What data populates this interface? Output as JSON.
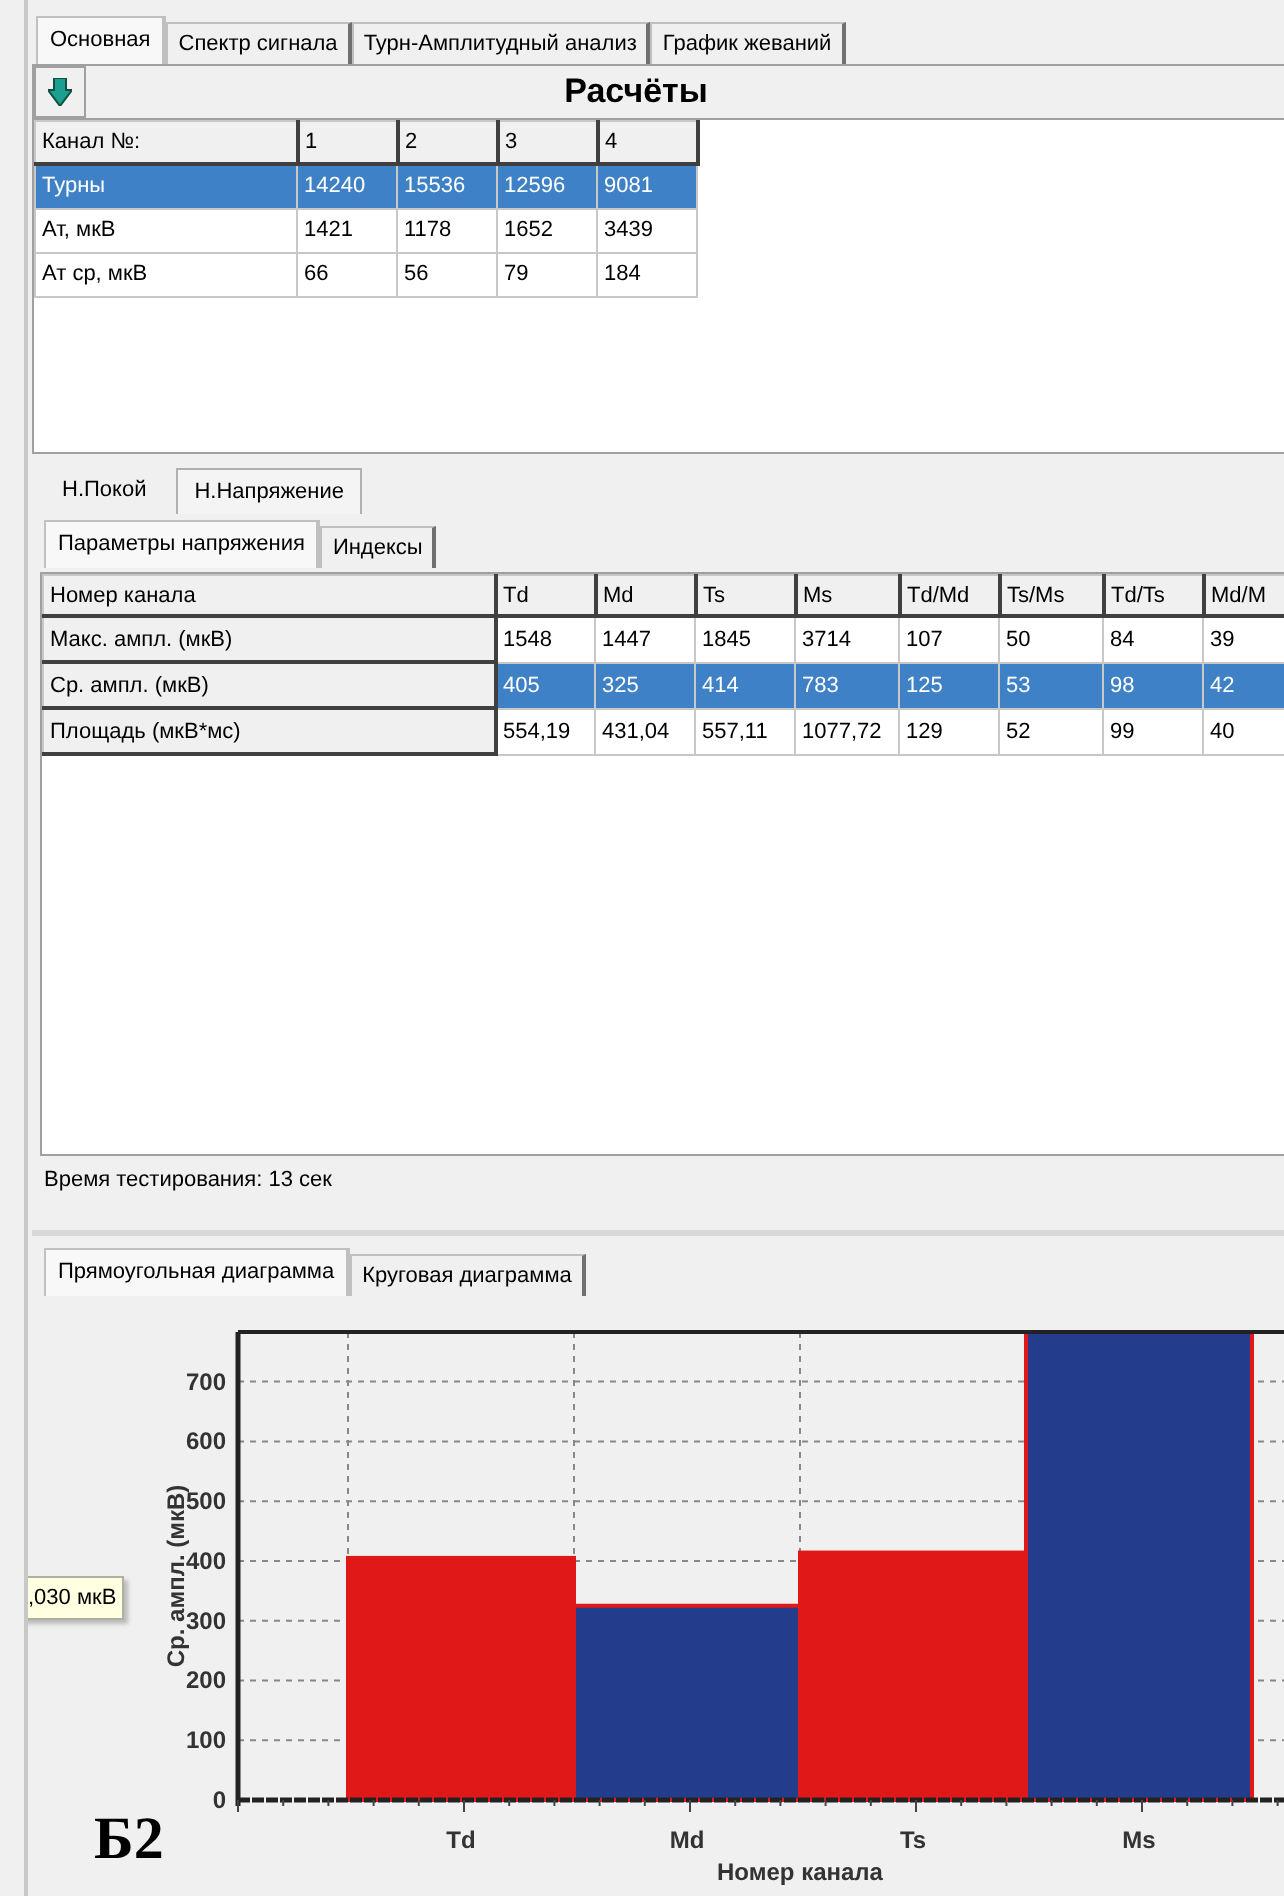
{
  "tabs": [
    {
      "label": "Основная",
      "selected": true
    },
    {
      "label": "Спектр сигнала",
      "selected": false
    },
    {
      "label": "Турн-Амплитудный анализ",
      "selected": false
    },
    {
      "label": "График жеваний",
      "selected": false
    }
  ],
  "calc_panel": {
    "title": "Расчёты",
    "table": {
      "columns": [
        "Канал №:",
        "1",
        "2",
        "3",
        "4"
      ],
      "rows": [
        {
          "cells": [
            "Турны",
            "14240",
            "15536",
            "12596",
            "9081"
          ],
          "selected": true
        },
        {
          "cells": [
            "Ат, мкВ",
            "1421",
            "1178",
            "1652",
            "3439"
          ],
          "selected": false
        },
        {
          "cells": [
            "Ат ср, мкВ",
            "66",
            "56",
            "79",
            "184"
          ],
          "selected": false
        }
      ]
    }
  },
  "mode_tabs": [
    {
      "label": "Н.Покой",
      "selected": false
    },
    {
      "label": "Н.Напряжение",
      "selected": true
    }
  ],
  "param_tabs": [
    {
      "label": "Параметры напряжения",
      "selected": true
    },
    {
      "label": "Индексы",
      "selected": false
    }
  ],
  "params_table": {
    "columns": [
      "Номер канала",
      "Td",
      "Md",
      "Ts",
      "Ms",
      "Td/Md",
      "Ts/Ms",
      "Td/Ts",
      "Md/M"
    ],
    "rows": [
      {
        "cells": [
          "Макс. ампл. (мкВ)",
          "1548",
          "1447",
          "1845",
          "3714",
          "107",
          "50",
          "84",
          "39"
        ],
        "selected": false
      },
      {
        "cells": [
          "Ср. ампл. (мкВ)",
          "405",
          "325",
          "414",
          "783",
          "125",
          "53",
          "98",
          "42"
        ],
        "selected": true
      },
      {
        "cells": [
          "Площадь (мкВ*мс)",
          "554,19",
          "431,04",
          "557,11",
          "1077,72",
          "129",
          "52",
          "99",
          "40"
        ],
        "selected": false
      }
    ]
  },
  "status": "Время тестирования: 13 сек",
  "chart_tabs": [
    {
      "label": "Прямоугольная диаграмма",
      "selected": true
    },
    {
      "label": "Круговая диаграмма",
      "selected": false
    }
  ],
  "chart_data": {
    "type": "bar",
    "xlabel": "Номер канала",
    "ylabel": "Ср. ампл. (мкВ)",
    "categories": [
      "Td",
      "Md",
      "Ts",
      "Ms"
    ],
    "series": [
      {
        "color": "#e01818",
        "values": [
          405,
          null,
          414,
          null
        ]
      },
      {
        "color": "#243c8c",
        "values": [
          null,
          325,
          null,
          783
        ]
      }
    ],
    "stacked": true,
    "grid": true,
    "ylim": [
      0,
      783
    ],
    "yticks": [
      0,
      100,
      200,
      300,
      400,
      500,
      600,
      700
    ]
  },
  "tooltip": ",030 мкВ",
  "figure_label": "Б2"
}
